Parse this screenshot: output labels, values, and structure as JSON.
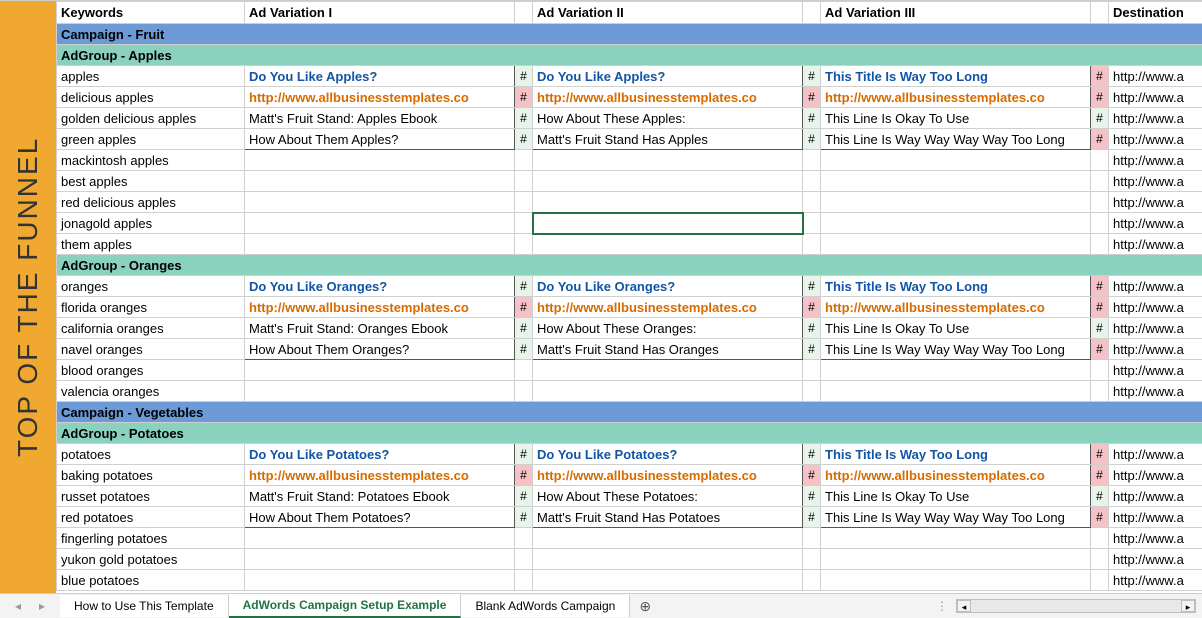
{
  "sidebar_label": "TOP OF THE FUNNEL",
  "headers": {
    "keywords": "Keywords",
    "ad1": "Ad Variation I",
    "ad2": "Ad Variation II",
    "ad3": "Ad Variation III",
    "dest": "Destination"
  },
  "hash": "#",
  "url": "http://www.allbusinesstemplates.co",
  "dest_stub": "http://www.a",
  "campaigns": [
    {
      "name": "Campaign - Fruit",
      "adgroups": [
        {
          "name": "AdGroup - Apples",
          "keywords": [
            "apples",
            "delicious apples",
            "golden delicious apples",
            "green apples",
            "mackintosh apples",
            "best apples",
            "red delicious apples",
            "jonagold apples",
            "them apples"
          ],
          "ads": [
            {
              "title": "Do You Like Apples?",
              "desc1": "Matt's Fruit Stand: Apples Ebook",
              "desc2": "How About Them Apples?",
              "h": [
                "ok",
                "bad",
                "ok",
                "ok"
              ]
            },
            {
              "title": "Do You Like Apples?",
              "desc1": "How About These Apples:",
              "desc2": "Matt's Fruit Stand Has Apples",
              "h": [
                "ok",
                "bad",
                "ok",
                "ok"
              ]
            },
            {
              "title": "This Title Is Way Too Long",
              "desc1": "This Line Is Okay To Use",
              "desc2": "This Line Is Way Way Way Way Too Long",
              "h": [
                "bad",
                "bad",
                "ok",
                "bad"
              ]
            }
          ]
        },
        {
          "name": "AdGroup - Oranges",
          "keywords": [
            "oranges",
            "florida oranges",
            "california oranges",
            "navel oranges",
            "blood oranges",
            "valencia oranges"
          ],
          "ads": [
            {
              "title": "Do You Like Oranges?",
              "desc1": "Matt's Fruit Stand: Oranges Ebook",
              "desc2": "How About Them Oranges?",
              "h": [
                "ok",
                "bad",
                "ok",
                "ok"
              ]
            },
            {
              "title": "Do You Like Oranges?",
              "desc1": "How About These Oranges:",
              "desc2": "Matt's Fruit Stand Has Oranges",
              "h": [
                "ok",
                "bad",
                "ok",
                "ok"
              ]
            },
            {
              "title": "This Title Is Way Too Long",
              "desc1": "This Line Is Okay To Use",
              "desc2": "This Line Is Way Way Way Way Too Long",
              "h": [
                "bad",
                "bad",
                "ok",
                "bad"
              ]
            }
          ]
        }
      ]
    },
    {
      "name": "Campaign - Vegetables",
      "adgroups": [
        {
          "name": "AdGroup - Potatoes",
          "keywords": [
            "potatoes",
            "baking potatoes",
            "russet potatoes",
            "red potatoes",
            "fingerling potatoes",
            "yukon gold potatoes",
            "blue potatoes"
          ],
          "ads": [
            {
              "title": "Do You Like Potatoes?",
              "desc1": "Matt's Fruit Stand: Potatoes Ebook",
              "desc2": "How About Them Potatoes?",
              "h": [
                "ok",
                "bad",
                "ok",
                "ok"
              ]
            },
            {
              "title": "Do You Like Potatoes?",
              "desc1": "How About These Potatoes:",
              "desc2": "Matt's Fruit Stand Has Potatoes",
              "h": [
                "ok",
                "bad",
                "ok",
                "ok"
              ]
            },
            {
              "title": "This Title Is Way Too Long",
              "desc1": "This Line Is Okay To Use",
              "desc2": "This Line Is Way Way Way Way Too Long",
              "h": [
                "bad",
                "bad",
                "ok",
                "bad"
              ]
            }
          ]
        }
      ]
    }
  ],
  "selected": {
    "campaign": 0,
    "adgroup": 0,
    "row": 7,
    "col": "ad2"
  },
  "tabs": {
    "t1": "How to Use This Template",
    "t2": "AdWords Campaign Setup Example",
    "t3": "Blank AdWords Campaign"
  }
}
